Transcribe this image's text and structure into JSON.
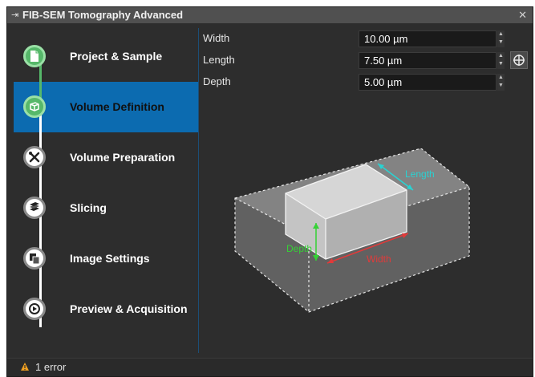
{
  "window": {
    "title": "FIB-SEM Tomography Advanced",
    "pin_glyph": "⇥",
    "close_glyph": "✕"
  },
  "steps": [
    {
      "label": "Project & Sample",
      "icon": "document-icon",
      "state": "done"
    },
    {
      "label": "Volume Definition",
      "icon": "cube-icon",
      "state": "active"
    },
    {
      "label": "Volume Preparation",
      "icon": "tools-icon",
      "state": "pending"
    },
    {
      "label": "Slicing",
      "icon": "slices-icon",
      "state": "pending"
    },
    {
      "label": "Image Settings",
      "icon": "images-icon",
      "state": "pending"
    },
    {
      "label": "Preview & Acquisition",
      "icon": "play-icon",
      "state": "pending"
    }
  ],
  "params": {
    "width": {
      "label": "Width",
      "value": "10.00 µm"
    },
    "length": {
      "label": "Length",
      "value": "7.50 µm"
    },
    "depth": {
      "label": "Depth",
      "value": "5.00 µm"
    }
  },
  "diagram": {
    "length_label": "Length",
    "width_label": "Width",
    "depth_label": "Depth",
    "colors": {
      "length": "#2ad2d2",
      "width": "#e23a3a",
      "depth": "#35d235"
    }
  },
  "status": {
    "text": "1 error",
    "icon": "warning-icon",
    "color": "#f0a020"
  },
  "colors": {
    "accent": "#0c6bb0",
    "done": "#56b86a"
  }
}
